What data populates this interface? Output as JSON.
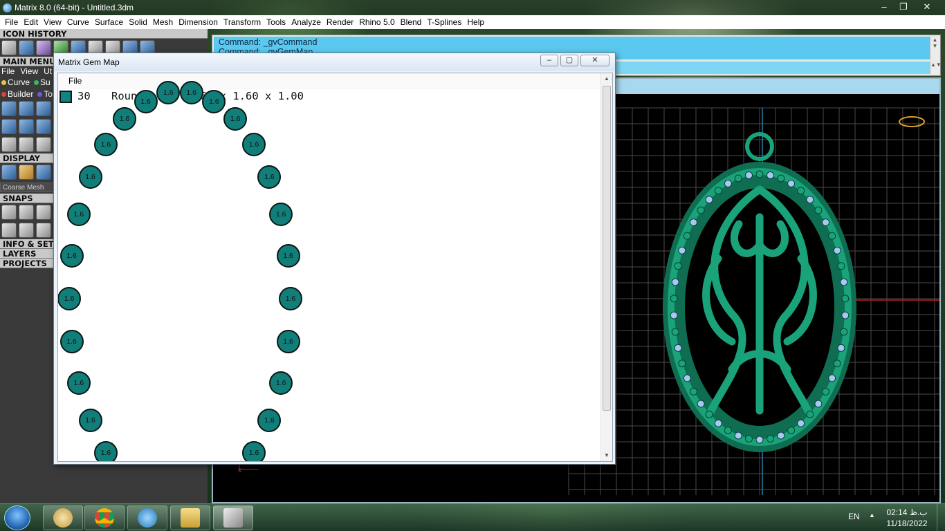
{
  "app": {
    "title": "Matrix 8.0 (64-bit) - Untitled.3dm",
    "window_controls": [
      "–",
      "❐",
      "✕"
    ]
  },
  "menubar": [
    "File",
    "Edit",
    "View",
    "Curve",
    "Surface",
    "Solid",
    "Mesh",
    "Dimension",
    "Transform",
    "Tools",
    "Analyze",
    "Render",
    "Rhino 5.0",
    "Blend",
    "T-Splines",
    "Help"
  ],
  "left_panel": {
    "icon_history": "ICON HISTORY",
    "main_menu": "MAIN MENU",
    "mini_menu": [
      "File",
      "View",
      "Ut"
    ],
    "categories_row1": [
      {
        "label": "Curve",
        "color": "#e6c34a"
      },
      {
        "label": "Su",
        "color": "#3db56a"
      }
    ],
    "categories_row2": [
      {
        "label": "Builder",
        "color": "#d8443a"
      },
      {
        "label": "To",
        "color": "#6b5bd6"
      }
    ],
    "display": "DISPLAY",
    "coarse_mesh": "Coarse Mesh",
    "snaps": "SNAPS",
    "info": "INFO & SET",
    "layers": "LAYERS",
    "projects": "PROJECTS"
  },
  "command": {
    "history_line1": "Command: _gvCommand",
    "history_line2": "Command: _gvGemMap",
    "prompt": "Command:"
  },
  "viewport": {
    "axis_label": "x",
    "colors": {
      "model": "#1aa37a",
      "stones": "#a9c7f5",
      "grid": "#4a4a4a",
      "axis": "#c62020"
    }
  },
  "gem_map": {
    "title": "Matrix Gem Map",
    "menu_file": "File",
    "count": "30",
    "shape": "Round",
    "size": "1.60 x 1.60 x 1.00",
    "gem_color": "#127e79",
    "gem_label": "1.6"
  },
  "taskbar": {
    "apps": [
      "paint-icon",
      "chrome-icon",
      "v8-icon",
      "explorer-icon",
      "matrix-icon"
    ],
    "lang": "EN",
    "time": "02:14 ب.ظ",
    "date": "11/18/2022"
  }
}
